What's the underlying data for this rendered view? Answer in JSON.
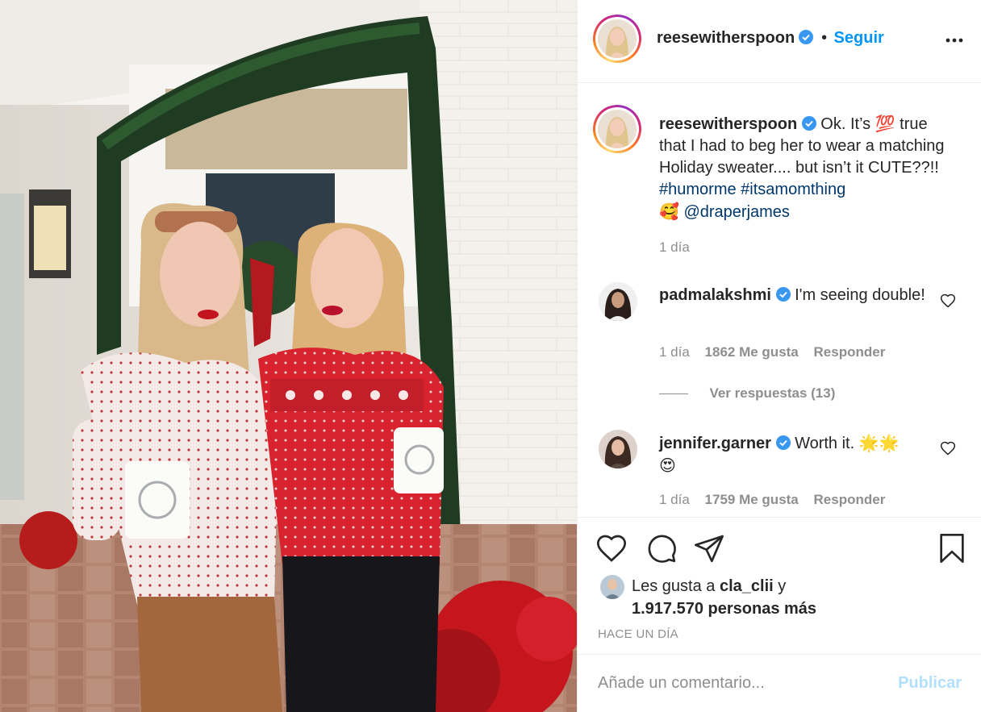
{
  "post": {
    "author": "reesewitherspoon",
    "follow_label": "Seguir",
    "separator": "•",
    "more_icon": "more-dots-icon",
    "caption": {
      "text_before": "Ok. It’s ",
      "emoji_100": "💯",
      "text_after": " true that I had to beg her to wear a matching Holiday sweater.... but isn’t it CUTE??!! ",
      "hashtag1": "#humorme",
      "hashtag2": "#itsamomthing",
      "emoji_smile": "🥰",
      "mention": "@draperjames",
      "time": "1 día"
    },
    "comments": [
      {
        "user": "padmalakshmi",
        "text": "I'm seeing double!",
        "time": "1 día",
        "likes": "1862 Me gusta",
        "reply_label": "Responder",
        "view_replies": "Ver respuestas (13)"
      },
      {
        "user": "jennifer.garner",
        "text": "Worth it. ",
        "emojis": "🌟🌟",
        "emoji2": "😍",
        "time": "1 día",
        "likes": "1759 Me gusta",
        "reply_label": "Responder"
      }
    ],
    "likes_prefix": "Les gusta a ",
    "likes_user": "cla_clii",
    "likes_mid": " y",
    "likes_count": "1.917.570 personas más",
    "posted_ago": "HACE UN DÍA",
    "comment_placeholder": "Añade un comentario...",
    "publish_label": "Publicar"
  },
  "colors": {
    "accent": "#0095f6",
    "link": "#00376b",
    "muted": "#8e8e8e",
    "publish_disabled": "#b2dffc"
  }
}
